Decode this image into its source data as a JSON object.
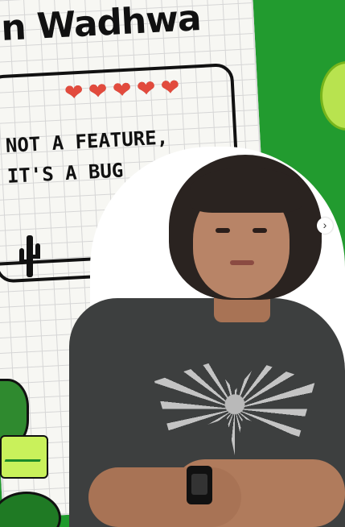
{
  "title": "n Wadhwa",
  "hearts": [
    "❤",
    "❤",
    "❤",
    "❤",
    "❤"
  ],
  "tagline": {
    "line1": "NOT A FEATURE,",
    "line2": "IT'S A BUG"
  },
  "colors": {
    "background_green": "#1f9a2c",
    "heart_red": "#e24b3d",
    "paper": "#f7f7f3"
  },
  "icons": {
    "next": "chevron-right-icon"
  }
}
